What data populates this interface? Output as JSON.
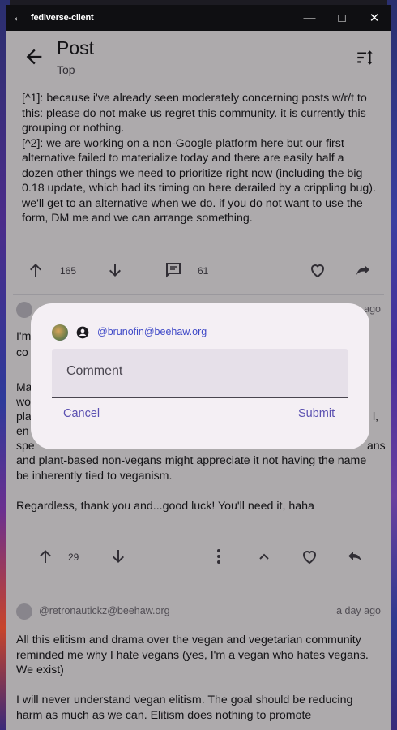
{
  "window": {
    "title": "fediverse-client"
  },
  "appbar": {
    "title": "Post",
    "subtitle": "Top"
  },
  "post": {
    "body": "[^1]: because i've already seen moderately concerning posts w/r/t to this: please do not make us regret this community. it is currently this grouping or nothing.\n[^2]: we are working on a non-Google platform here but our first alternative failed to materialize today and there are easily half a dozen other things we need to prioritize right now (including the big 0.18 update, which had its timing on here derailed by a crippling bug). we'll get to an alternative when we do. if you do not want to use the form, DM me and we can arrange something.",
    "upvotes": "165",
    "comments": "61"
  },
  "comment1": {
    "time": "ago",
    "partial_lines": [
      "I'm",
      "co",
      "",
      "Ma",
      "wo",
      "pla",
      "en",
      "spe"
    ],
    "right_fragments": [
      "l,",
      "ans"
    ],
    "body_tail": "and plant-based non-vegans might appreciate it not having the name be inherently tied to veganism.\n\nRegardless, thank you and...good luck! You'll need it, haha",
    "upvotes": "29"
  },
  "comment2": {
    "handle": "@retronautickz@beehaw.org",
    "time": "a day ago",
    "body": "All this elitism and drama over the vegan and vegetarian community reminded me why I hate vegans (yes, I'm a vegan who hates vegans. We exist)\n\nI will never understand vegan elitism. The goal should be reducing harm as much as we can. Elitism does nothing to promote"
  },
  "dialog": {
    "handle": "@brunofin@beehaw.org",
    "placeholder": "Comment",
    "cancel": "Cancel",
    "submit": "Submit"
  },
  "colors": {
    "accent": "#5a4fb0",
    "handle": "#3f49c7",
    "dialog_bg": "#f4eff4",
    "field_bg": "#e6e0e9"
  }
}
